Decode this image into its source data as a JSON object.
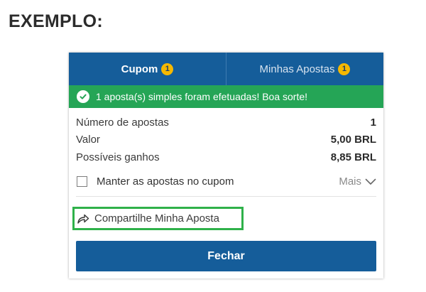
{
  "heading": "EXEMPLO:",
  "tabs": [
    {
      "label": "Cupom",
      "badge": "1",
      "active": true
    },
    {
      "label": "Minhas Apostas",
      "badge": "1",
      "active": false
    }
  ],
  "success_message": "1 aposta(s) simples foram efetuadas! Boa sorte!",
  "summary": {
    "num_bets_label": "Número de apostas",
    "num_bets_value": "1",
    "stake_label": "Valor",
    "stake_value": "5,00 BRL",
    "winnings_label": "Possíveis ganhos",
    "winnings_value": "8,85 BRL"
  },
  "keep_bets_label": "Manter as apostas no cupom",
  "keep_bets_checked": false,
  "more_label": "Mais",
  "share_label": "Compartilhe Minha Aposta",
  "close_label": "Fechar",
  "colors": {
    "header_blue": "#155d9a",
    "success_green": "#25a556",
    "badge_yellow": "#f5b800",
    "highlight_green": "#2fb14a"
  },
  "icons": {
    "success": "check-circle-icon",
    "more": "chevron-down-icon",
    "share": "share-arrow-icon"
  }
}
